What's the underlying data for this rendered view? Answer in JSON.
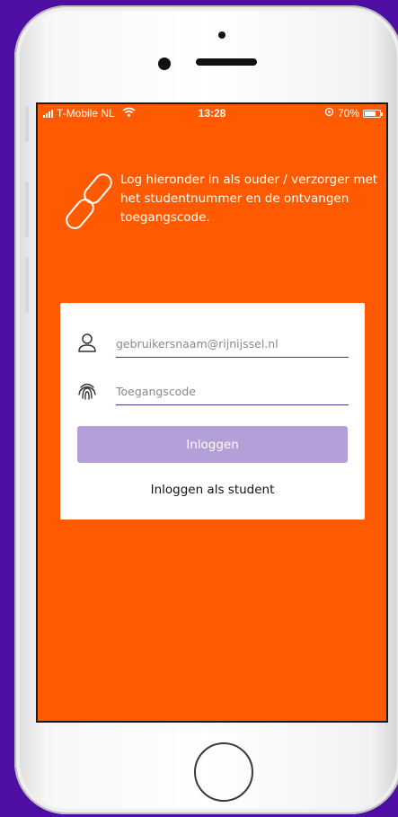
{
  "status_bar": {
    "carrier": "T-Mobile NL",
    "time": "13:28",
    "battery_percent": "70%"
  },
  "intro": {
    "message": "Log hieronder in als ouder / verzorger met het studentnummer en de ontvangen toegangscode."
  },
  "login_form": {
    "username_placeholder": "gebruikersnaam@rijnijssel.nl",
    "username_value": "",
    "access_code_placeholder": "Toegangscode",
    "access_code_value": "",
    "login_button_label": "Inloggen",
    "student_login_link": "Inloggen als student"
  },
  "icons": {
    "link": "link-icon",
    "user": "user-icon",
    "fingerprint": "fingerprint-icon",
    "wifi": "wifi-icon",
    "battery": "battery-icon",
    "signal": "signal-icon"
  },
  "colors": {
    "background": "#4f0ea3",
    "screen_accent": "#ff5a00",
    "button": "#b59fd9",
    "input_underline": "#5c2d91"
  }
}
